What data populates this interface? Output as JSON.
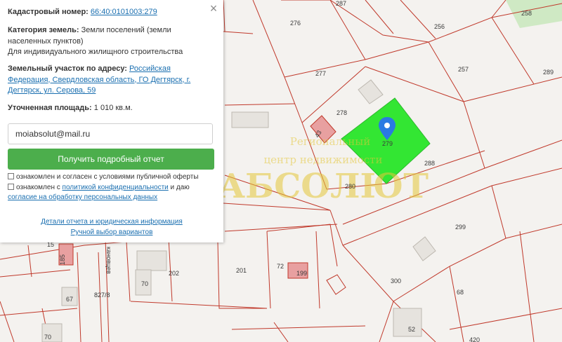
{
  "map": {
    "plot_numbers": {
      "p287": "287",
      "p276": "276",
      "p256": "256",
      "p258": "258",
      "p257": "257",
      "p277": "277",
      "p289": "289",
      "p278": "278",
      "p43": "43",
      "p279": "279",
      "p288": "288",
      "p280": "280",
      "p299": "299",
      "p202": "202",
      "p201": "201",
      "p72": "72",
      "p199": "199",
      "p70": "70",
      "p67": "67",
      "p300": "300",
      "p68": "68",
      "p52": "52",
      "p420": "420",
      "p70b": "70",
      "p15": "15",
      "p185": "185"
    },
    "street_labels": {
      "street1": "кановцев",
      "street2": "827/8"
    },
    "watermark": {
      "line1": "Региональный",
      "line2": "центр недвижимости",
      "line3": "АБСОЛЮТ"
    },
    "colors": {
      "selected_fill": "#33e633",
      "boundary": "#c0392b",
      "marker": "#2a7ae2",
      "watermark": "#e4c73a",
      "background": "#f4f2ef"
    },
    "icons": {
      "marker": "map-pin-icon"
    }
  },
  "panel": {
    "close_icon": "×",
    "cadastral_label": "Кадастровый номер:",
    "cadastral_number": "66:40:0101003:279",
    "category_label": "Категория земель:",
    "category_value": "Земли поселений (земли населенных пунктов)",
    "category_use": "Для индивидуального жилищного строительства",
    "address_label": "Земельный участок по адресу:",
    "address_value": "Российская Федерация, Свердловская область, ГО Дегтярск, г. Дегтярск, ул. Серова, 59",
    "area_label": "Уточненная площадь:",
    "area_value": "1 010 кв.м.",
    "email_value": "moiabsolut@mail.ru",
    "submit_label": "Получить подробный отчет",
    "consent_offer_text": "ознакомлен и согласен с условиями публичной оферты",
    "consent_privacy_prefix": "ознакомлен с",
    "consent_privacy_link": "политикой конфиденциальности",
    "consent_privacy_mid": "и даю",
    "consent_processing_link": "согласие на обработку персональных данных",
    "details_link": "Детали отчета и юридическая информация",
    "manual_link": "Ручной выбор вариантов"
  }
}
